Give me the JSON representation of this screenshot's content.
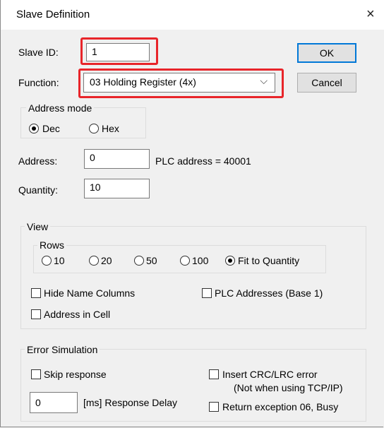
{
  "window": {
    "title": "Slave Definition",
    "close_glyph": "×"
  },
  "slave_id": {
    "label": "Slave ID:",
    "value": "1"
  },
  "function": {
    "label": "Function:",
    "selected": "03 Holding Register (4x)"
  },
  "buttons": {
    "ok": "OK",
    "cancel": "Cancel"
  },
  "address_mode": {
    "title": "Address mode",
    "dec": "Dec",
    "hex": "Hex",
    "selected": "Dec"
  },
  "address": {
    "label": "Address:",
    "value": "0",
    "plc_note": "PLC address = 40001"
  },
  "quantity": {
    "label": "Quantity:",
    "value": "10"
  },
  "view": {
    "title": "View",
    "rows_title": "Rows",
    "rows_options": [
      "10",
      "20",
      "50",
      "100",
      "Fit to Quantity"
    ],
    "rows_selected": "Fit to Quantity",
    "hide_name_columns": "Hide Name Columns",
    "plc_addresses": "PLC Addresses (Base 1)",
    "address_in_cell": "Address in Cell"
  },
  "error_sim": {
    "title": "Error Simulation",
    "skip_response": "Skip response",
    "response_delay_value": "0",
    "response_delay_label": "[ms] Response Delay",
    "insert_crc": "Insert CRC/LRC error",
    "insert_crc_note": "(Not when using TCP/IP)",
    "return_exception": "Return exception 06, Busy"
  },
  "colors": {
    "highlight": "#e8252a",
    "default_button_border": "#0078d7"
  }
}
